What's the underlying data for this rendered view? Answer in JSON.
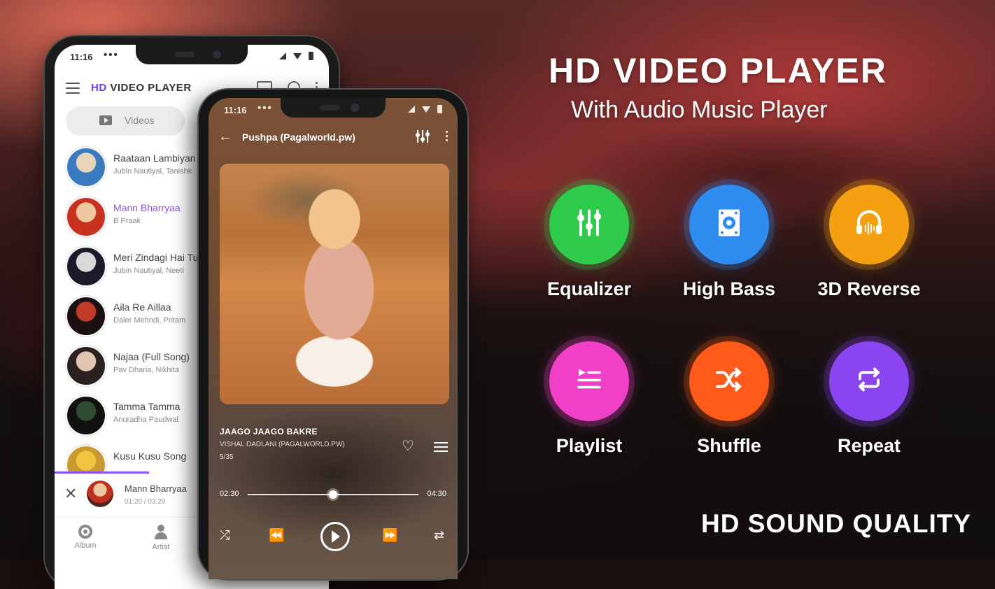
{
  "colors": {
    "accent_purple": "#8a52f0",
    "equalizer": "#2ecc4a",
    "high_bass": "#2f8cf0",
    "reverse_3d": "#f5a010",
    "playlist": "#f040c8",
    "shuffle": "#ff5a1a",
    "repeat": "#8a44f0"
  },
  "headline": {
    "title": "HD VIDEO PLAYER",
    "subtitle": "With Audio Music Player",
    "footer": "HD SOUND QUALITY"
  },
  "phone_left": {
    "status": {
      "time": "11:16",
      "dots": "•••"
    },
    "app_title_prefix": "HD",
    "app_title_rest": " VIDEO PLAYER",
    "tab_label": "Videos",
    "songs": [
      {
        "title": "Raataan Lambiyan",
        "subtitle": "Jubin Nautiyal, Tanishk",
        "active": false,
        "avatar": [
          "#e8d4b8",
          "#3a7ac0"
        ]
      },
      {
        "title": "Mann Bharryaa",
        "subtitle": "B Praak",
        "active": true,
        "avatar": [
          "#f0c8a0",
          "#c83020"
        ]
      },
      {
        "title": "Meri Zindagi Hai Tu",
        "subtitle": "Jubin Nautiyal, Neeti",
        "active": false,
        "avatar": [
          "#d9d9d9",
          "#1a1a2a"
        ]
      },
      {
        "title": "Aila Re Aillaa",
        "subtitle": "Daler Mehndi, Pritam",
        "active": false,
        "avatar": [
          "#c23b2a",
          "#1a1010"
        ]
      },
      {
        "title": "Najaa (Full Song)",
        "subtitle": "Pav Dharia, Nikhita",
        "active": false,
        "avatar": [
          "#e0c6b0",
          "#2a2020"
        ]
      },
      {
        "title": "Tamma Tamma",
        "subtitle": "Anuradha Paudwal",
        "active": false,
        "avatar": [
          "#2e4a30",
          "#111"
        ]
      },
      {
        "title": "Kusu Kusu Song",
        "subtitle": "",
        "active": false,
        "avatar": [
          "#f2c440",
          "#c89a30"
        ]
      }
    ],
    "mini_player": {
      "title": "Mann Bharryaa",
      "time": "01:20 / 03:20"
    },
    "bottom_nav": [
      {
        "label": "Album"
      },
      {
        "label": "Artist"
      }
    ]
  },
  "phone_right": {
    "status": {
      "time": "11:16",
      "dots": "•••"
    },
    "title": "Pushpa (Pagalworld.pw)",
    "track": {
      "title": "JAAGO JAAGO BAKRE",
      "artist": "VISHAL DADLANI (PAGALWORLD.PW)",
      "index": "5/35"
    },
    "seek": {
      "current": "02:30",
      "total": "04:30",
      "progress": 0.5
    }
  },
  "features": [
    {
      "label": "Equalizer",
      "icon": "equalizer-icon",
      "color_key": "equalizer"
    },
    {
      "label": "High Bass",
      "icon": "speaker-icon",
      "color_key": "high_bass"
    },
    {
      "label": "3D Reverse",
      "icon": "headphones-icon",
      "color_key": "reverse_3d"
    },
    {
      "label": "Playlist",
      "icon": "playlist-icon",
      "color_key": "playlist"
    },
    {
      "label": "Shuffle",
      "icon": "shuffle-icon",
      "color_key": "shuffle"
    },
    {
      "label": "Repeat",
      "icon": "repeat-icon",
      "color_key": "repeat"
    }
  ]
}
